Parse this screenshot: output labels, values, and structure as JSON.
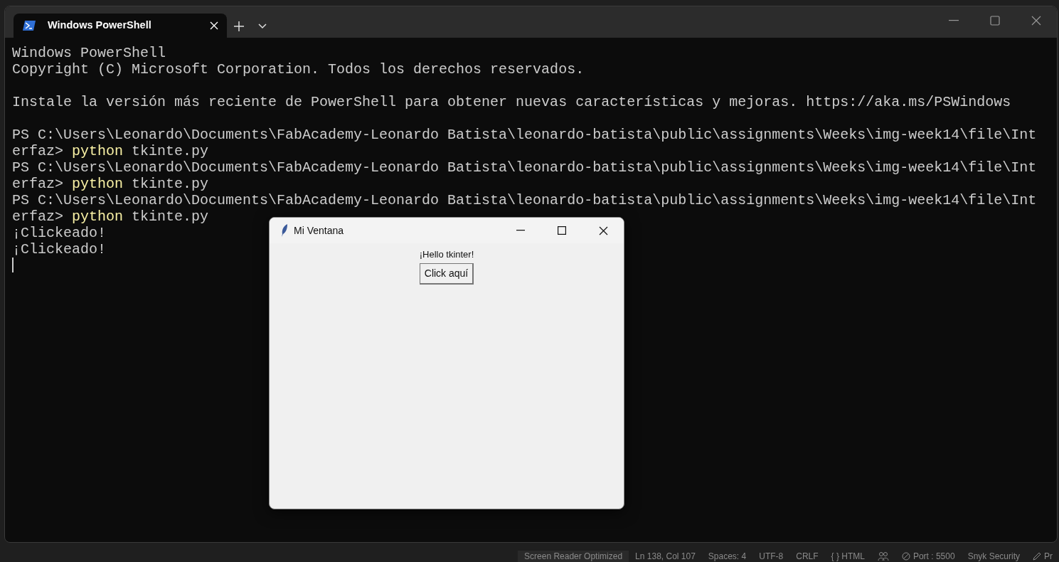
{
  "terminal": {
    "tabs": [
      {
        "label": "Windows PowerShell",
        "selected": true
      }
    ],
    "lines": [
      {
        "kind": "text",
        "text": "Windows PowerShell"
      },
      {
        "kind": "text",
        "text": "Copyright (C) Microsoft Corporation. Todos los derechos reservados."
      },
      {
        "kind": "blank"
      },
      {
        "kind": "text",
        "text": "Instale la versión más reciente de PowerShell para obtener nuevas características y mejoras. https://aka.ms/PSWindows"
      },
      {
        "kind": "blank"
      },
      {
        "kind": "text",
        "text": "PS C:\\Users\\Leonardo\\Documents\\FabAcademy-Leonardo Batista\\leonardo-batista\\public\\assignments\\Weeks\\img-week14\\file\\Int"
      },
      {
        "kind": "command",
        "prompt": "erfaz>",
        "command": "python",
        "args": "tkinte.py"
      },
      {
        "kind": "text",
        "text": "PS C:\\Users\\Leonardo\\Documents\\FabAcademy-Leonardo Batista\\leonardo-batista\\public\\assignments\\Weeks\\img-week14\\file\\Int"
      },
      {
        "kind": "command",
        "prompt": "erfaz>",
        "command": "python",
        "args": "tkinte.py"
      },
      {
        "kind": "text",
        "text": "PS C:\\Users\\Leonardo\\Documents\\FabAcademy-Leonardo Batista\\leonardo-batista\\public\\assignments\\Weeks\\img-week14\\file\\Int"
      },
      {
        "kind": "command",
        "prompt": "erfaz>",
        "command": "python",
        "args": "tkinte.py"
      },
      {
        "kind": "text",
        "text": "¡Clickeado!"
      },
      {
        "kind": "text",
        "text": "¡Clickeado!"
      },
      {
        "kind": "cursor"
      }
    ]
  },
  "tk_window": {
    "title": "Mi Ventana",
    "label": "¡Hello tkinter!",
    "button": "Click aquí"
  },
  "status_bar": [
    {
      "kind": "highlight",
      "text": "Screen Reader Optimized"
    },
    {
      "kind": "plain",
      "text": "Ln 138, Col 107"
    },
    {
      "kind": "plain",
      "text": "Spaces: 4"
    },
    {
      "kind": "plain",
      "text": "UTF-8"
    },
    {
      "kind": "plain",
      "text": "CRLF"
    },
    {
      "kind": "plain",
      "text": "{ } HTML"
    },
    {
      "kind": "people"
    },
    {
      "kind": "port",
      "text": "Port : 5500"
    },
    {
      "kind": "plain",
      "text": "Snyk Security"
    },
    {
      "kind": "pen",
      "text": "Pr"
    }
  ]
}
